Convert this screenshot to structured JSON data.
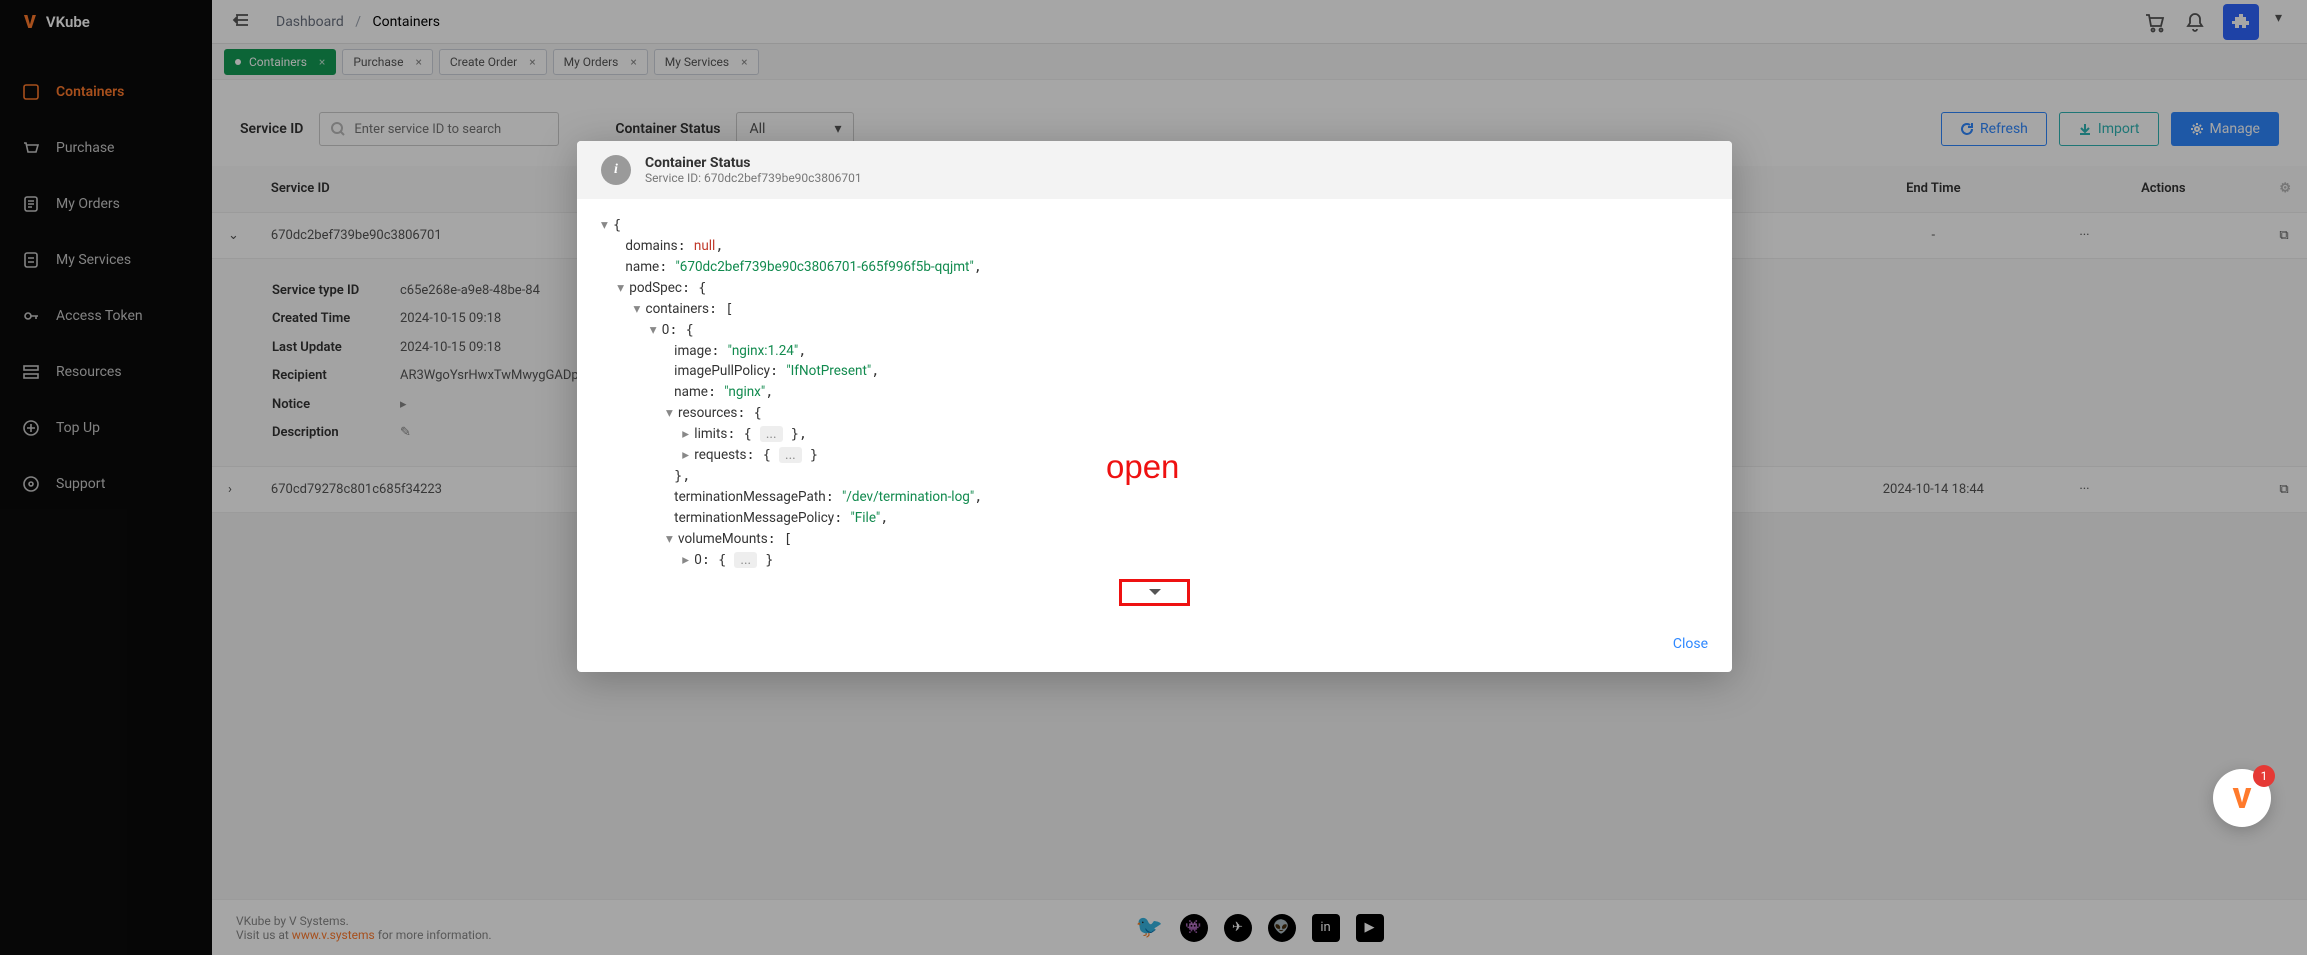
{
  "brand": {
    "name": "VKube"
  },
  "nav": {
    "items": [
      {
        "label": "Containers",
        "active": true,
        "icon": "containers-icon"
      },
      {
        "label": "Purchase",
        "active": false,
        "icon": "cart-icon"
      },
      {
        "label": "My Orders",
        "active": false,
        "icon": "orders-icon"
      },
      {
        "label": "My Services",
        "active": false,
        "icon": "services-icon"
      },
      {
        "label": "Access Token",
        "active": false,
        "icon": "key-icon"
      },
      {
        "label": "Resources",
        "active": false,
        "icon": "resources-icon"
      },
      {
        "label": "Top Up",
        "active": false,
        "icon": "topup-icon"
      },
      {
        "label": "Support",
        "active": false,
        "icon": "support-icon"
      }
    ]
  },
  "breadcrumb": {
    "root": "Dashboard",
    "leaf": "Containers"
  },
  "tabs": [
    {
      "label": "Containers",
      "active": true
    },
    {
      "label": "Purchase",
      "active": false
    },
    {
      "label": "Create Order",
      "active": false
    },
    {
      "label": "My Orders",
      "active": false
    },
    {
      "label": "My Services",
      "active": false
    }
  ],
  "filter": {
    "service_id_label": "Service ID",
    "search_placeholder": "Enter service ID to search",
    "status_label": "Container Status",
    "status_value": "All"
  },
  "buttons": {
    "refresh": "Refresh",
    "import": "Import",
    "manage": "Manage"
  },
  "table": {
    "headers": {
      "service_id": "Service ID",
      "end_time": "End Time",
      "actions": "Actions"
    },
    "rows": [
      {
        "service_id": "670dc2bef739be90c3806701",
        "end_time": "-",
        "actions": "···",
        "expanded": true
      },
      {
        "service_id": "670cd79278c801c685f34223",
        "end_time": "2024-10-14 18:44",
        "actions": "···",
        "expanded": false
      }
    ]
  },
  "detail": {
    "rows": [
      {
        "label": "Service type ID",
        "value": "c65e268e-a9e8-48be-84"
      },
      {
        "label": "Created Time",
        "value": "2024-10-15 09:18"
      },
      {
        "label": "Last Update",
        "value": "2024-10-15 09:18"
      },
      {
        "label": "Recipient",
        "value": "AR3WgoYsrHwxTwMwygGADp"
      },
      {
        "label": "Notice",
        "value": ""
      },
      {
        "label": "Description",
        "value": ""
      }
    ]
  },
  "footer": {
    "line1": "VKube by V Systems.",
    "line2a": "Visit us at ",
    "line2link": "www.v.systems",
    "line2b": " for more information."
  },
  "help": {
    "badge": "1"
  },
  "modal": {
    "title": "Container Status",
    "sub_label": "Service ID: ",
    "sub_value": "670dc2bef739be90c3806701",
    "close": "Close",
    "json": {
      "domains": "null",
      "name": "\"670dc2bef739be90c3806701-665f996f5b-qqjmt\"",
      "podSpec_key": "podSpec",
      "containers_key": "containers",
      "image": "\"nginx:1.24\"",
      "imagePullPolicy": "\"IfNotPresent\"",
      "cname": "\"nginx\"",
      "resources_key": "resources",
      "limits_key": "limits",
      "requests_key": "requests",
      "tmPath_key": "terminationMessagePath",
      "tmPath": "\"/dev/termination-log\"",
      "tmPolicy_key": "terminationMessagePolicy",
      "tmPolicy": "\"File\"",
      "volumeMounts_key": "volumeMounts"
    }
  },
  "annotation": "open",
  "chart_data": null
}
